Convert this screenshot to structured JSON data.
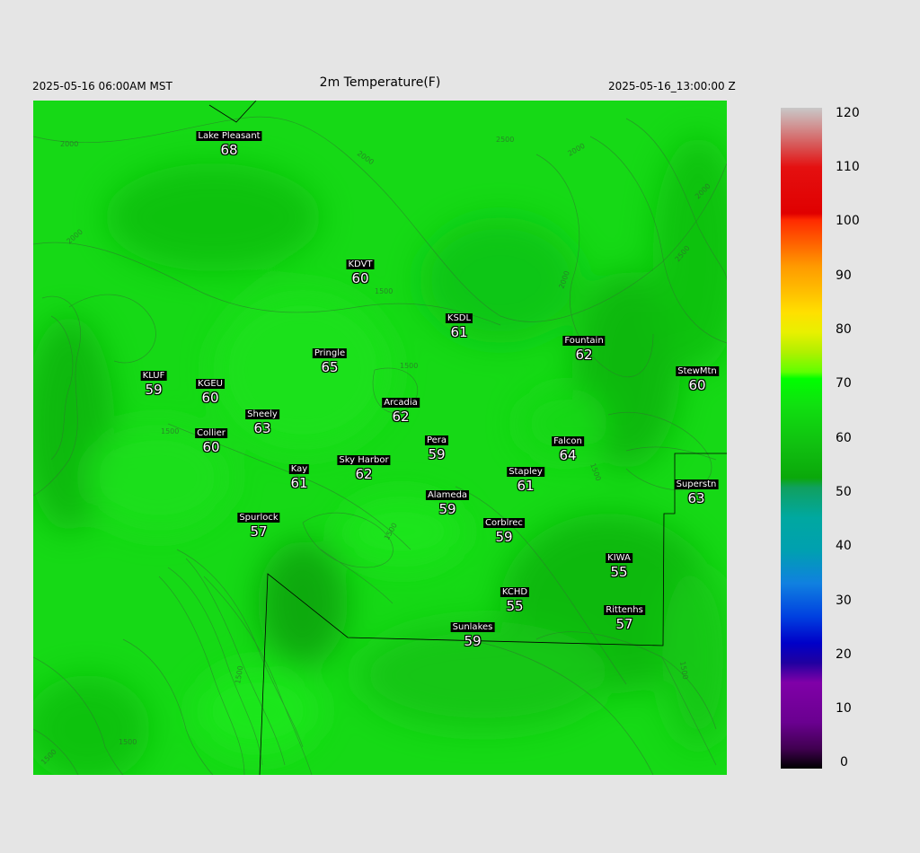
{
  "header": {
    "local_time": "2025-05-16 06:00AM MST",
    "title": "2m Temperature(F)",
    "utc_time": "2025-05-16_13:00:00 Z"
  },
  "stations": [
    {
      "name": "Lake Pleasant",
      "value": "68"
    },
    {
      "name": "KDVT",
      "value": "60"
    },
    {
      "name": "KSDL",
      "value": "61"
    },
    {
      "name": "Fountain",
      "value": "62"
    },
    {
      "name": "StewMtn",
      "value": "60"
    },
    {
      "name": "Pringle",
      "value": "65"
    },
    {
      "name": "KLUF",
      "value": "59"
    },
    {
      "name": "KGEU",
      "value": "60"
    },
    {
      "name": "Arcadia",
      "value": "62"
    },
    {
      "name": "Sheely",
      "value": "63"
    },
    {
      "name": "Collier",
      "value": "60"
    },
    {
      "name": "Pera",
      "value": "59"
    },
    {
      "name": "Falcon",
      "value": "64"
    },
    {
      "name": "Sky Harbor",
      "value": "62"
    },
    {
      "name": "Kay",
      "value": "61"
    },
    {
      "name": "Stapley",
      "value": "61"
    },
    {
      "name": "Superstn",
      "value": "63"
    },
    {
      "name": "Alameda",
      "value": "59"
    },
    {
      "name": "Spurlock",
      "value": "57"
    },
    {
      "name": "Corblrec",
      "value": "59"
    },
    {
      "name": "KIWA",
      "value": "55"
    },
    {
      "name": "KCHD",
      "value": "55"
    },
    {
      "name": "Rittenhs",
      "value": "57"
    },
    {
      "name": "Sunlakes",
      "value": "59"
    }
  ],
  "contour_labels": [
    "2000",
    "2000",
    "2500",
    "2000",
    "2000",
    "1500",
    "2000",
    "1500",
    "1500",
    "1500",
    "1500",
    "1500",
    "1500",
    "1500",
    "1500",
    "2500",
    "2000"
  ],
  "colorbar": {
    "ticks": [
      "120",
      "110",
      "100",
      "90",
      "80",
      "70",
      "60",
      "50",
      "40",
      "30",
      "20",
      "10",
      "0"
    ]
  },
  "colors": {
    "field_base": "#16d916",
    "field_dark": "#0fbf10",
    "contour": "#2e7a2e",
    "boundary": "#000000"
  }
}
